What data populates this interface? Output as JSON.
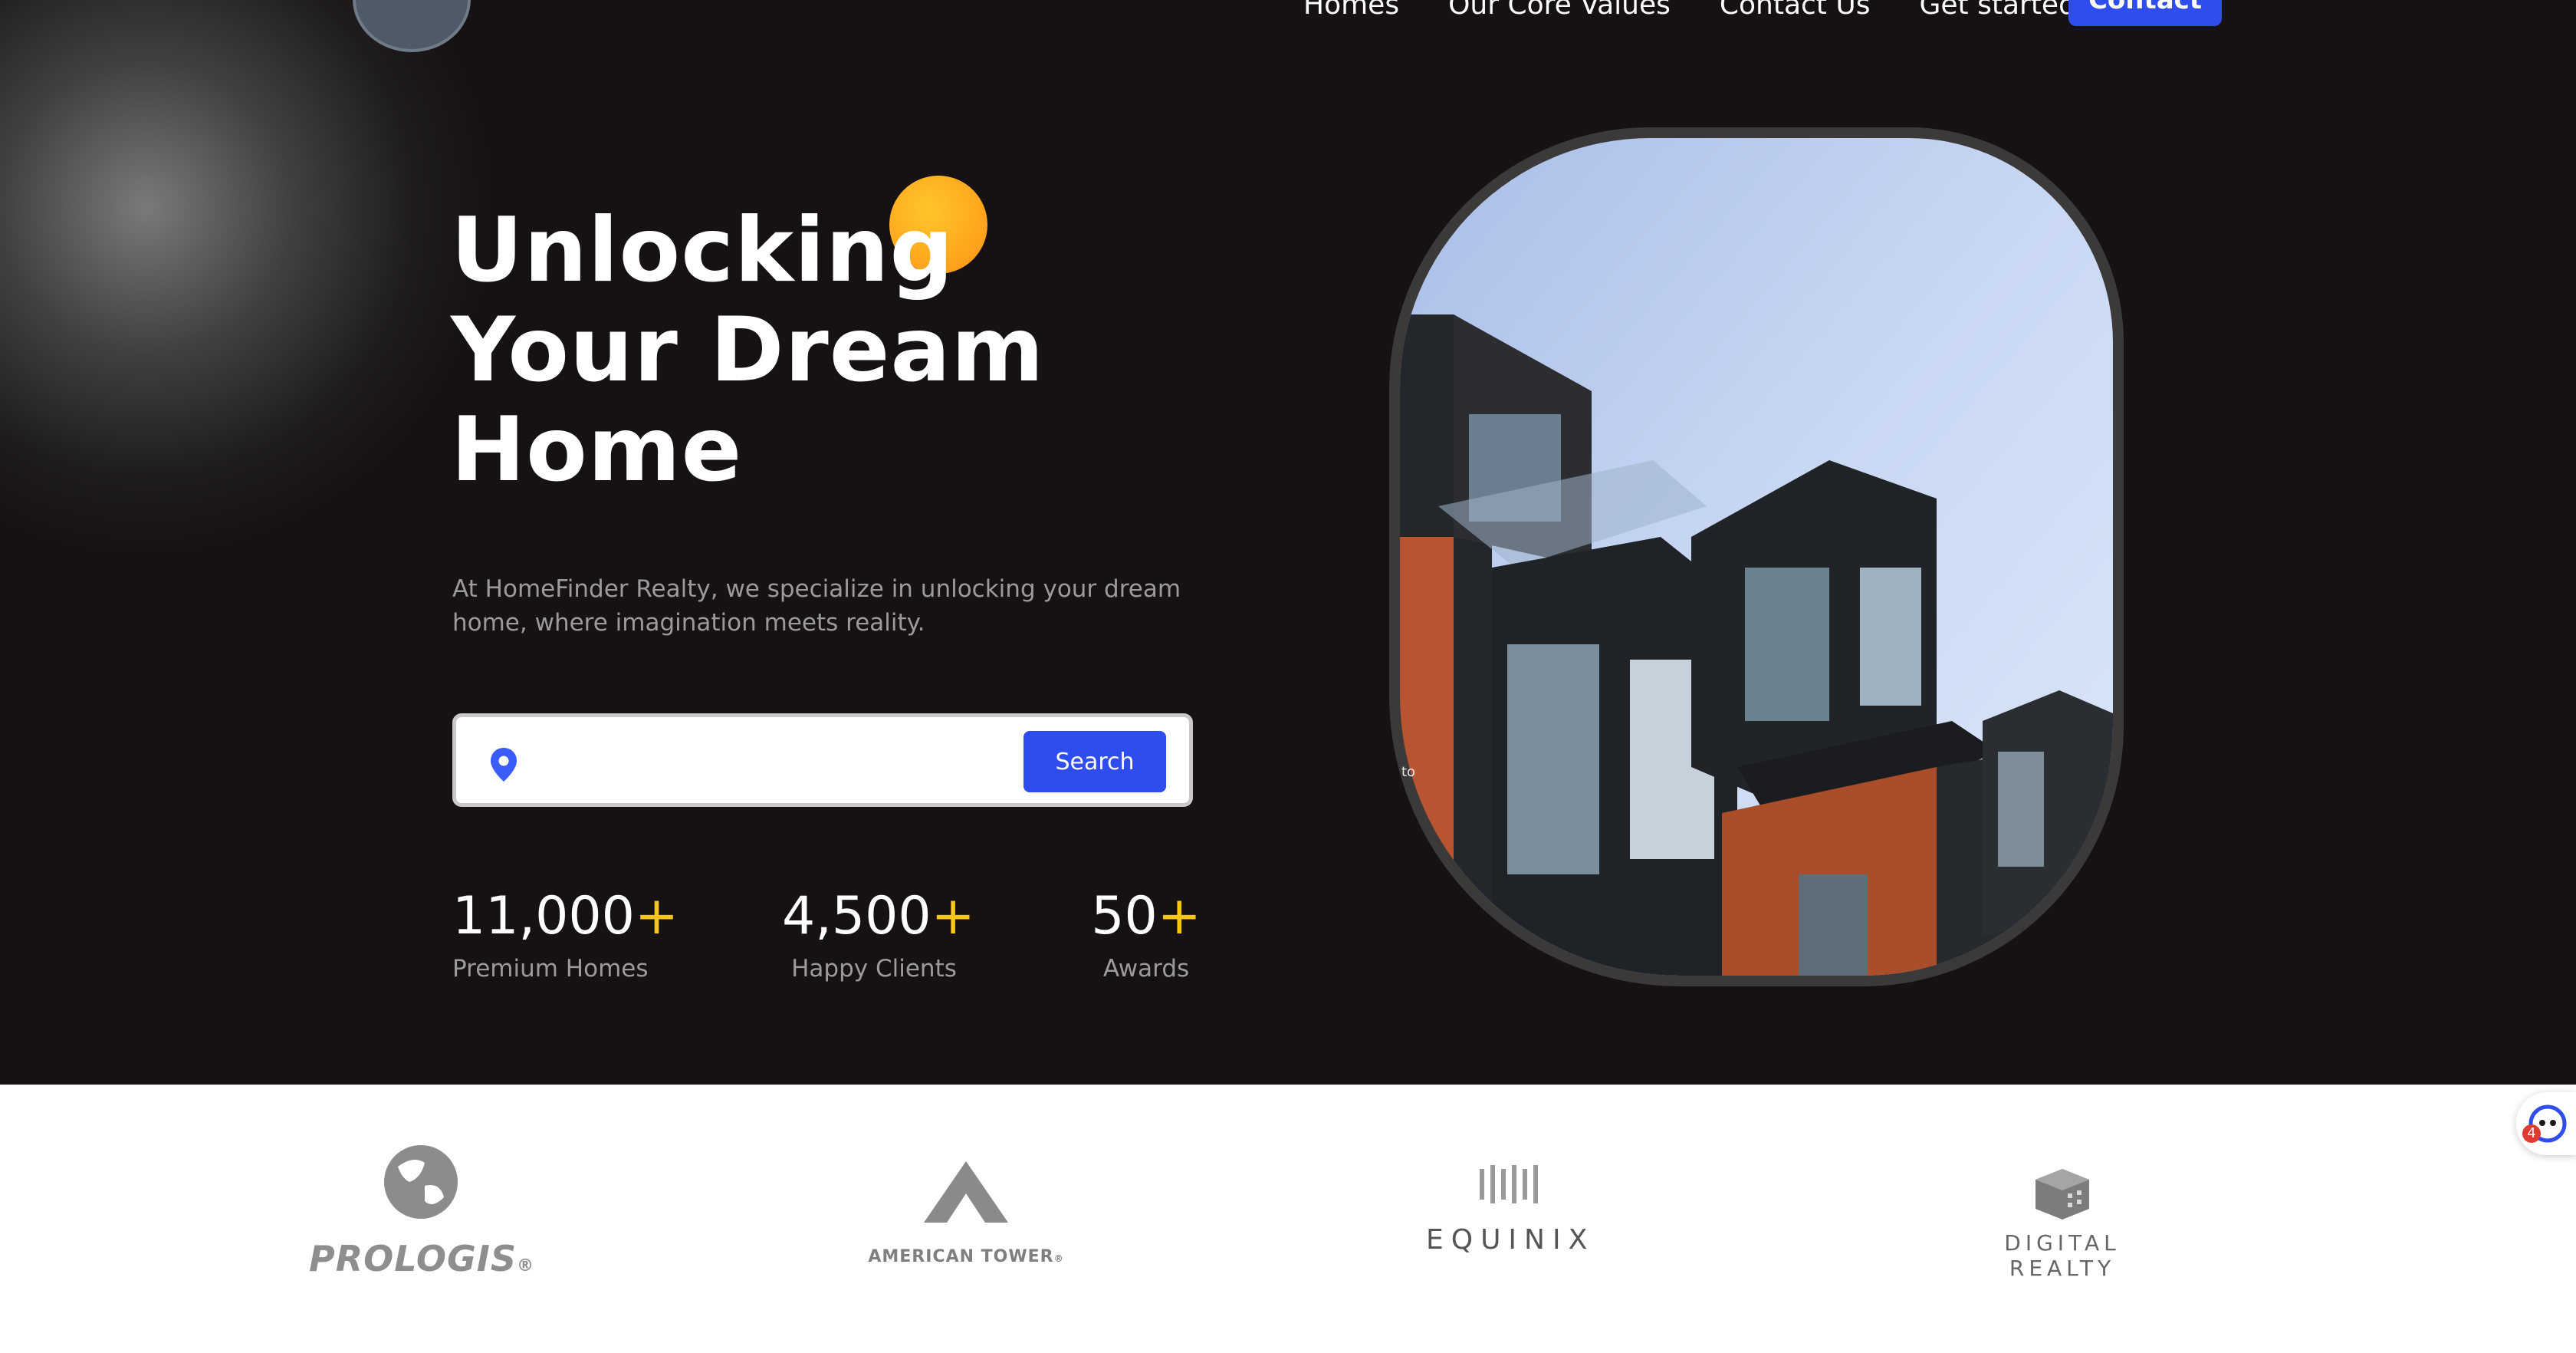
{
  "nav": {
    "items": [
      "Homes",
      "Our Core Values",
      "Contact Us",
      "Get started"
    ],
    "contact_label": "Contact"
  },
  "hero": {
    "title_lines": [
      "Unlocking",
      "Your Dream",
      "Home"
    ],
    "description": "At HomeFinder Realty, we specialize in unlocking your dream home, where imagination meets reality.",
    "search": {
      "placeholder": "",
      "button_label": "Search",
      "icon": "location-pin-icon"
    },
    "image_caption": "to",
    "stats": [
      {
        "value": "11,000",
        "suffix": "+",
        "label": "Premium Homes"
      },
      {
        "value": "4,500",
        "suffix": "+",
        "label": "Happy Clients"
      },
      {
        "value": "50",
        "suffix": "+",
        "label": "Awards"
      }
    ]
  },
  "partners": [
    {
      "name": "PROLOGIS",
      "suffix": "®",
      "icon": "globe-logo-icon"
    },
    {
      "name": "AMERICAN TOWER",
      "suffix": "®",
      "icon": "tower-logo-icon"
    },
    {
      "name": "EQUINIX",
      "icon": "equinix-logo-icon"
    },
    {
      "name": "DIGITAL REALTY",
      "icon": "cube-logo-icon"
    }
  ],
  "chat_widget": {
    "badge_count": "4",
    "icon": "chat-assistant-icon"
  },
  "colors": {
    "hero_bg": "#161213",
    "accent_blue": "#2f4cef",
    "accent_yellow": "#f8c51c",
    "orange_dot": "#ffa21c"
  }
}
